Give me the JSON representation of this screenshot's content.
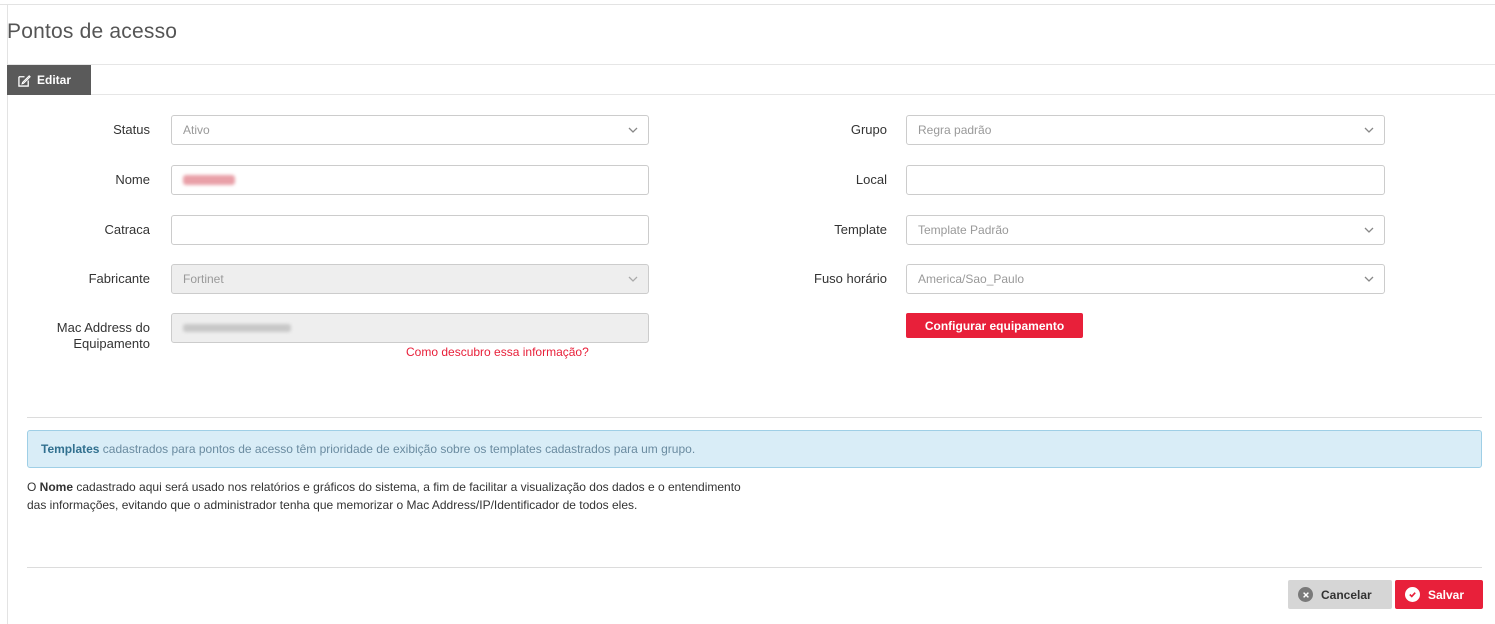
{
  "page": {
    "title": "Pontos de acesso"
  },
  "tabs": {
    "edit_label": "Editar"
  },
  "form": {
    "status": {
      "label": "Status",
      "value": "Ativo"
    },
    "nome": {
      "label": "Nome"
    },
    "catraca": {
      "label": "Catraca",
      "value": ""
    },
    "fabricante": {
      "label": "Fabricante",
      "value": "Fortinet"
    },
    "mac": {
      "label_line1": "Mac Address do",
      "label_line2": "Equipamento",
      "help_link": "Como descubro essa informação?"
    },
    "grupo": {
      "label": "Grupo",
      "value": "Regra padrão"
    },
    "local": {
      "label": "Local",
      "value": ""
    },
    "template": {
      "label": "Template",
      "value": "Template Padrão"
    },
    "fuso": {
      "label": "Fuso horário",
      "value": "America/Sao_Paulo"
    },
    "configure_button": "Configurar equipamento"
  },
  "alert": {
    "bold": "Templates",
    "text": " cadastrados para pontos de acesso têm prioridade de exibição sobre os templates cadastrados para um grupo."
  },
  "note": {
    "prefix": "O ",
    "bold": "Nome",
    "text": " cadastrado aqui será usado nos relatórios e gráficos do sistema, a fim de facilitar a visualização dos dados e o entendimento das informações, evitando que o administrador tenha que memorizar o Mac Address/IP/Identificador de todos eles."
  },
  "actions": {
    "cancel": "Cancelar",
    "save": "Salvar"
  },
  "colors": {
    "accent": "#e8203a",
    "tab": "#5a5a5a",
    "alert_bg": "#d9edf7"
  }
}
